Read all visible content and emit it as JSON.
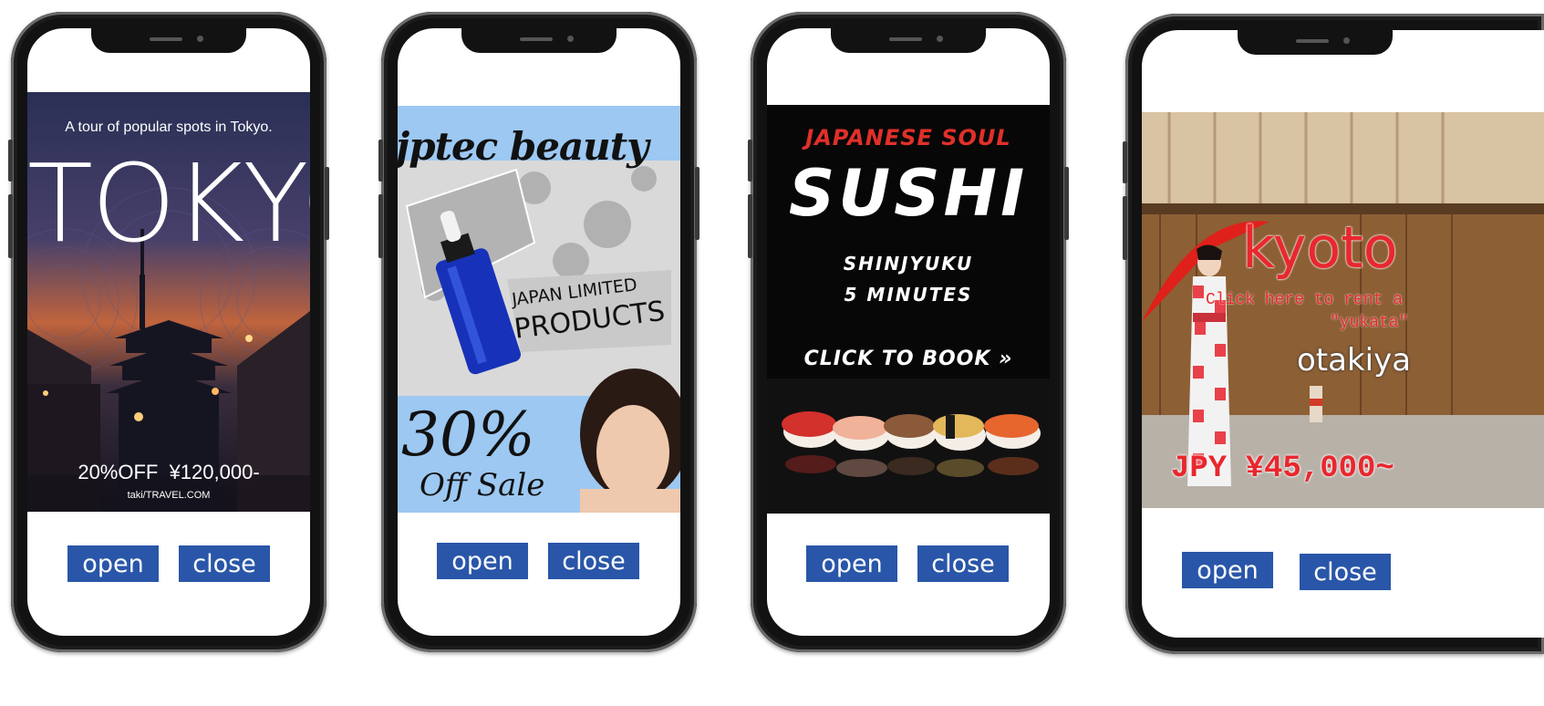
{
  "ads": [
    {
      "tagline": "A tour of popular spots in Tokyo.",
      "headline": "TOKYO",
      "price": "20%OFF  ¥120,000-",
      "site": "taki/TRAVEL.COM"
    },
    {
      "brand": "jptec beauty",
      "label_line1": "JAPAN LIMITED",
      "label_line2": "PRODUCTS",
      "discount": "30%",
      "sale": "Off Sale"
    },
    {
      "kicker": "JAPANESE SOUL",
      "headline": "SUSHI",
      "location_line1": "SHINJYUKU",
      "location_line2": "5 MINUTES",
      "cta": "CLICK TO BOOK »"
    },
    {
      "city": "kyoto",
      "rent_line1": "Click here to rent a",
      "rent_line2": "\"yukata\"",
      "shop": "otakiya",
      "price": "JPY ¥45,000~"
    }
  ],
  "buttons": {
    "open": "open",
    "close": "close"
  },
  "colors": {
    "button": "#2956a8",
    "sushi_kicker": "#e0302a",
    "kyoto_text": "#e8282e",
    "beauty_bg": "#9cc8f2"
  }
}
